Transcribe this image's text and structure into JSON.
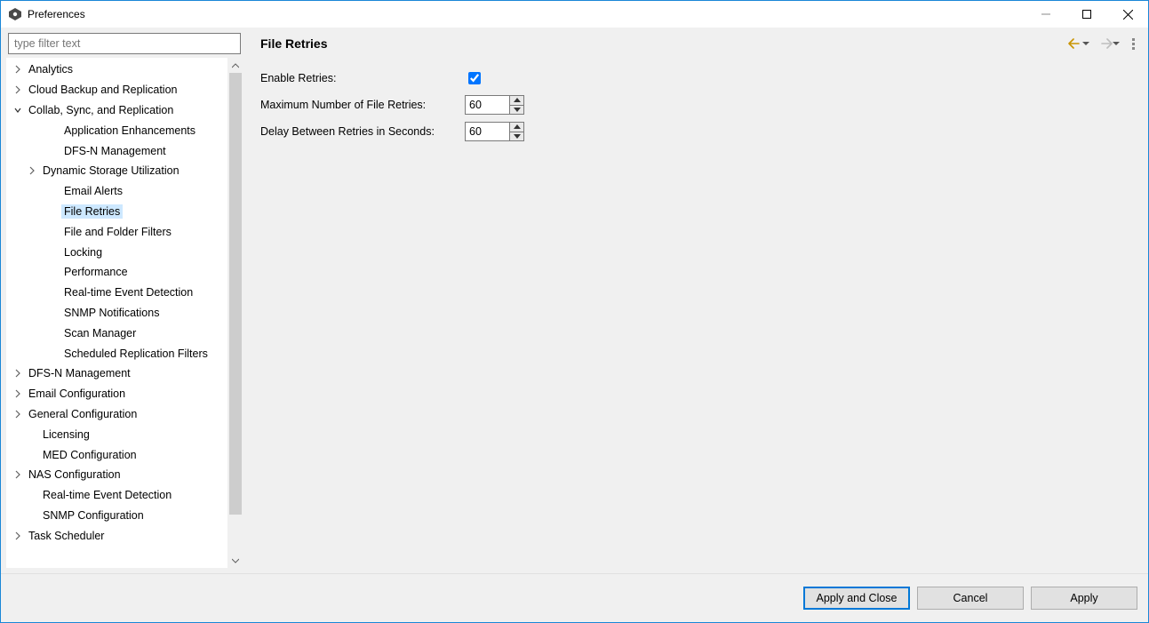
{
  "window": {
    "title": "Preferences"
  },
  "filter": {
    "placeholder": "type filter text"
  },
  "tree": {
    "items": [
      {
        "label": "Analytics",
        "indent": 1,
        "chev": "right",
        "selected": false
      },
      {
        "label": "Cloud Backup and Replication",
        "indent": 1,
        "chev": "right",
        "selected": false
      },
      {
        "label": "Collab, Sync, and Replication",
        "indent": 1,
        "chev": "down",
        "selected": false
      },
      {
        "label": "Application Enhancements",
        "indent": 3,
        "chev": "",
        "selected": false
      },
      {
        "label": "DFS-N Management",
        "indent": 3,
        "chev": "",
        "selected": false
      },
      {
        "label": "Dynamic Storage Utilization",
        "indent": 2,
        "chev": "right",
        "selected": false
      },
      {
        "label": "Email Alerts",
        "indent": 3,
        "chev": "",
        "selected": false
      },
      {
        "label": "File Retries",
        "indent": 3,
        "chev": "",
        "selected": true
      },
      {
        "label": "File and Folder Filters",
        "indent": 3,
        "chev": "",
        "selected": false
      },
      {
        "label": "Locking",
        "indent": 3,
        "chev": "",
        "selected": false
      },
      {
        "label": "Performance",
        "indent": 3,
        "chev": "",
        "selected": false
      },
      {
        "label": "Real-time Event Detection",
        "indent": 3,
        "chev": "",
        "selected": false
      },
      {
        "label": "SNMP Notifications",
        "indent": 3,
        "chev": "",
        "selected": false
      },
      {
        "label": "Scan Manager",
        "indent": 3,
        "chev": "",
        "selected": false
      },
      {
        "label": "Scheduled Replication Filters",
        "indent": 3,
        "chev": "",
        "selected": false
      },
      {
        "label": "DFS-N Management",
        "indent": 1,
        "chev": "right",
        "selected": false
      },
      {
        "label": "Email Configuration",
        "indent": 1,
        "chev": "right",
        "selected": false
      },
      {
        "label": "General Configuration",
        "indent": 1,
        "chev": "right",
        "selected": false
      },
      {
        "label": "Licensing",
        "indent": 2,
        "chev": "",
        "selected": false
      },
      {
        "label": "MED Configuration",
        "indent": 2,
        "chev": "",
        "selected": false
      },
      {
        "label": "NAS Configuration",
        "indent": 1,
        "chev": "right",
        "selected": false
      },
      {
        "label": "Real-time Event Detection",
        "indent": 2,
        "chev": "",
        "selected": false
      },
      {
        "label": "SNMP Configuration",
        "indent": 2,
        "chev": "",
        "selected": false
      },
      {
        "label": "Task Scheduler",
        "indent": 1,
        "chev": "right",
        "selected": false
      }
    ]
  },
  "page": {
    "title": "File Retries",
    "enable_label": "Enable Retries:",
    "enable_checked": true,
    "max_label": "Maximum Number of File Retries:",
    "max_value": "60",
    "delay_label": "Delay Between Retries in Seconds:",
    "delay_value": "60"
  },
  "buttons": {
    "apply_close": "Apply and Close",
    "cancel": "Cancel",
    "apply": "Apply"
  }
}
